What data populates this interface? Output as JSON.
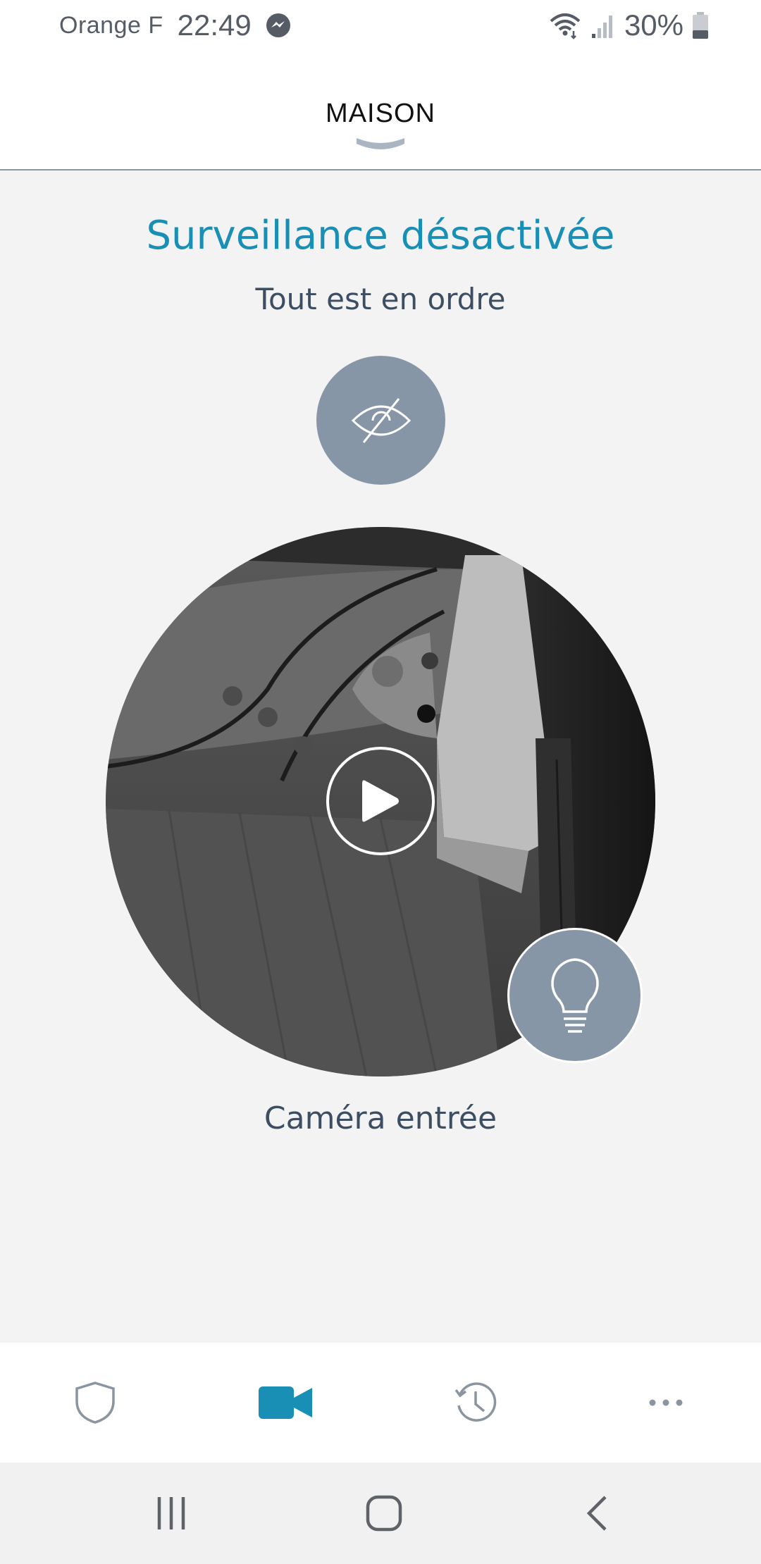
{
  "status_bar": {
    "carrier": "Orange F",
    "time": "22:49",
    "battery": "30%",
    "icons": [
      "messenger-icon",
      "wifi-icon",
      "signal-icon",
      "battery-icon"
    ]
  },
  "header": {
    "title": "MAISON",
    "dropdown_icon": "chevron-down-icon"
  },
  "main": {
    "status_title": "Surveillance désactivée",
    "status_subtitle": "Tout est en ordre",
    "privacy_icon": "eye-off-icon",
    "camera": {
      "name": "Caméra entrée",
      "play_icon": "play-icon",
      "light_icon": "lightbulb-icon"
    }
  },
  "tab_bar": {
    "tabs": [
      {
        "icon": "shield-icon",
        "active": false
      },
      {
        "icon": "video-camera-icon",
        "active": true
      },
      {
        "icon": "history-icon",
        "active": false
      },
      {
        "icon": "more-icon",
        "active": false
      }
    ]
  },
  "nav_bar": {
    "buttons": [
      "recent-apps-icon",
      "home-icon",
      "back-icon"
    ]
  },
  "colors": {
    "accent": "#1a8fb5",
    "icon_circle": "#8796a6",
    "text": "#3d4e63",
    "inactive_icon": "#8a95a0"
  }
}
